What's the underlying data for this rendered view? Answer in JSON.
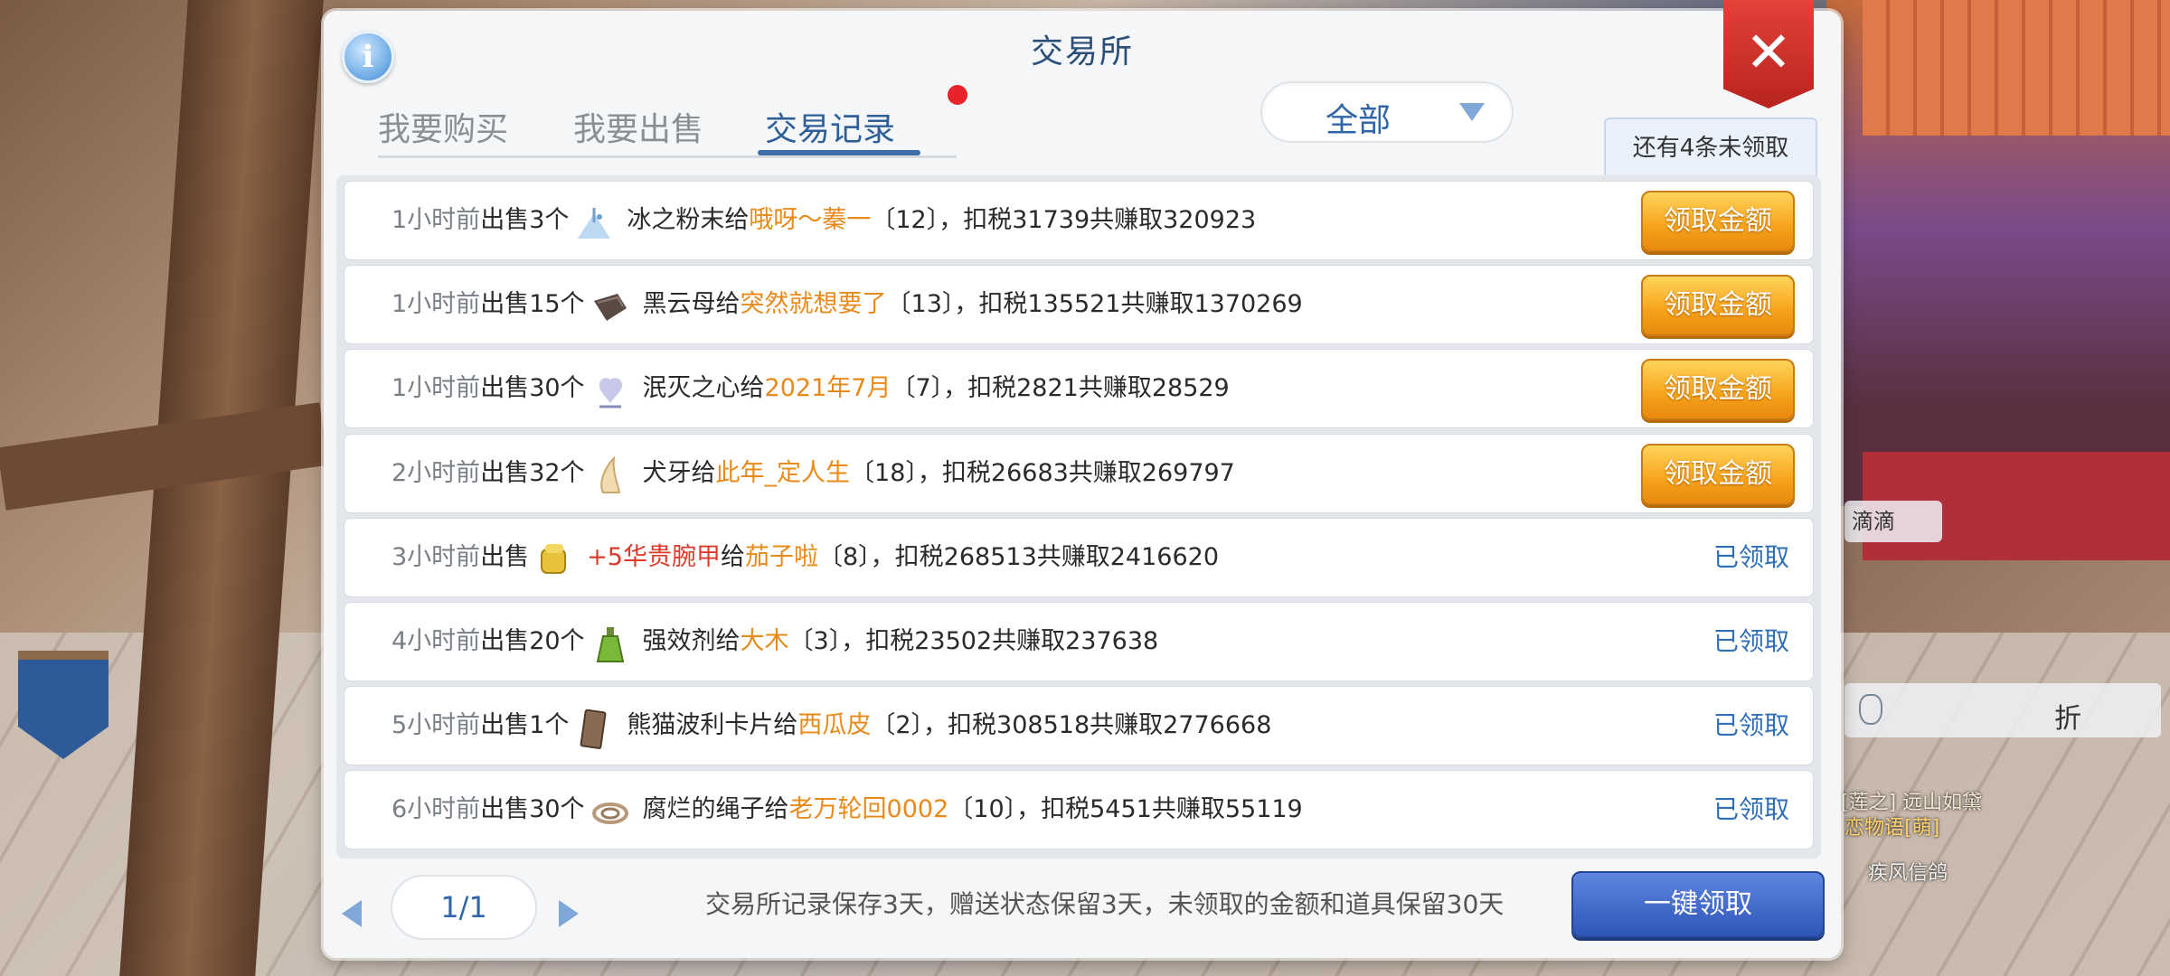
{
  "window": {
    "title": "交易所",
    "close_label": "✕",
    "info_label": "i"
  },
  "tabs": [
    {
      "label": "我要购买",
      "active": false
    },
    {
      "label": "我要出售",
      "active": false
    },
    {
      "label": "交易记录",
      "active": true
    }
  ],
  "filter": {
    "value": "全部"
  },
  "unclaimed_notice": "还有4条未领取",
  "records": [
    {
      "time": "1小时前",
      "verb": "出售",
      "qty": "3个",
      "icon": "ice-powder-icon",
      "item": "冰之粉末",
      "to": "给",
      "buyer": "哦呀～蓁一",
      "detail": "〔12〕，扣税31739共赚取320923",
      "action": "领取金额",
      "claimed": false
    },
    {
      "time": "1小时前",
      "verb": "出售",
      "qty": "15个",
      "icon": "mica-icon",
      "item": "黑云母",
      "to": "给",
      "buyer": "突然就想要了",
      "detail": "〔13〕，扣税135521共赚取1370269",
      "action": "领取金额",
      "claimed": false
    },
    {
      "time": "1小时前",
      "verb": "出售",
      "qty": "30个",
      "icon": "heart-icon",
      "item": "泯灭之心",
      "to": "给",
      "buyer": "2021年7月",
      "detail": "〔7〕，扣税2821共赚取28529",
      "action": "领取金额",
      "claimed": false
    },
    {
      "time": "2小时前",
      "verb": "出售",
      "qty": "32个",
      "icon": "fang-icon",
      "item": "犬牙",
      "to": "给",
      "buyer": "此年_定人生",
      "detail": "〔18〕，扣税26683共赚取269797",
      "action": "领取金额",
      "claimed": false
    },
    {
      "time": "3小时前",
      "verb": "出售",
      "qty": "",
      "icon": "gauntlet-icon",
      "item": "+5华贵腕甲",
      "to": "给",
      "buyer": "茄子啦",
      "detail": "〔8〕，扣税268513共赚取2416620",
      "action": "已领取",
      "claimed": true
    },
    {
      "time": "4小时前",
      "verb": "出售",
      "qty": "20个",
      "icon": "potion-icon",
      "item": "强效剂",
      "to": "给",
      "buyer": "大木",
      "detail": "〔3〕，扣税23502共赚取237638",
      "action": "已领取",
      "claimed": true
    },
    {
      "time": "5小时前",
      "verb": "出售",
      "qty": "1个",
      "icon": "card-icon",
      "item": "熊猫波利卡片",
      "to": "给",
      "buyer": "西瓜皮",
      "detail": "〔2〕，扣税308518共赚取2776668",
      "action": "已领取",
      "claimed": true
    },
    {
      "time": "6小时前",
      "verb": "出售",
      "qty": "30个",
      "icon": "rope-icon",
      "item": "腐烂的绳子",
      "to": "给",
      "buyer": "老万轮回0002",
      "detail": "〔10〕，扣税5451共赚取55119",
      "action": "已领取",
      "claimed": true
    }
  ],
  "pager": {
    "label": "1/1"
  },
  "footer_note": "交易所记录保存3天，赠送状态保留3天，未领取的金额和道具保留30天",
  "claim_all_label": "一键领取",
  "background": {
    "chip_a": "滴滴",
    "chip_b": "折",
    "name_1": "[莲之] 远山如黛",
    "name_2": "恋物语[萌]",
    "name_3": "疾风信鸽"
  },
  "colors": {
    "buyer": "#e88a1a",
    "rare_item": "#dc3a2a",
    "accent": "#2f5f98",
    "claim_button": "#f6a21a",
    "claimed_text": "#2f6fb8"
  }
}
